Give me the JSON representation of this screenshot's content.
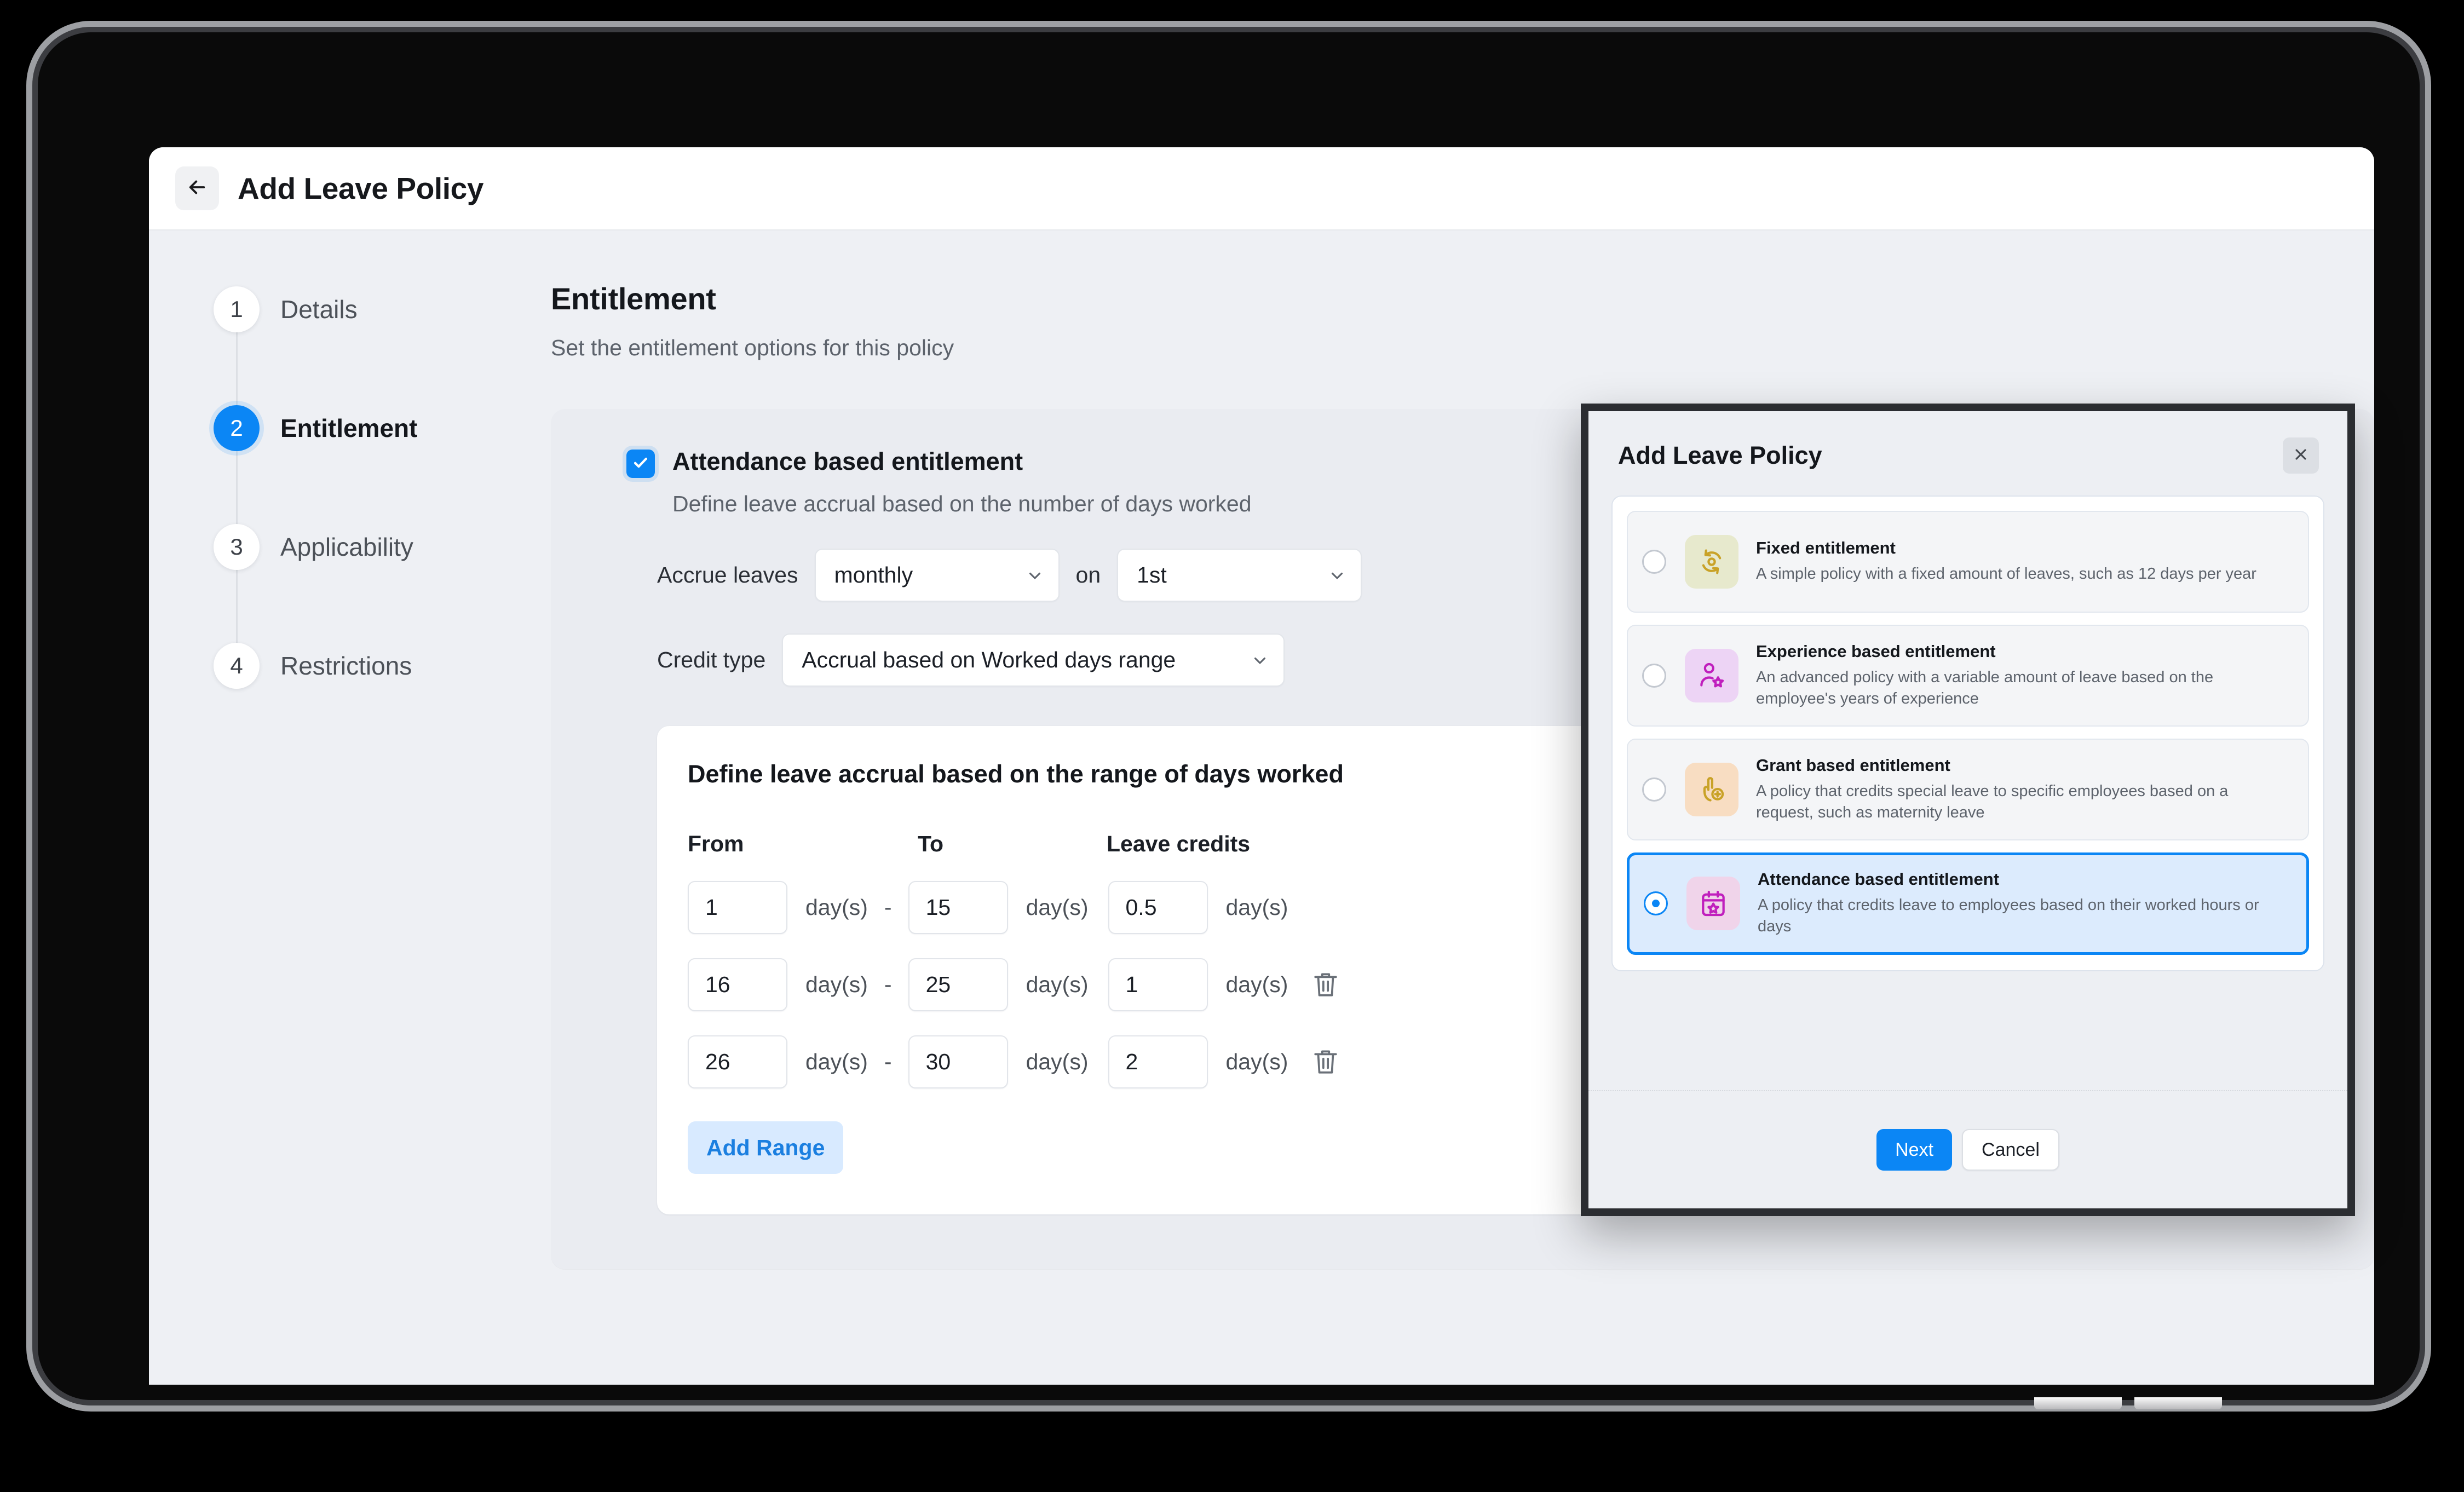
{
  "colors": {
    "accent": "#0b86f5",
    "panel_bg": "#eef0f4",
    "card_bg": "#eaecf1",
    "modal_border": "#2b2d31",
    "add_range_bg": "#d8eaff",
    "add_range_fg": "#1b7fe0"
  },
  "topbar": {
    "back_icon": "arrow-left-icon",
    "title": "Add Leave Policy"
  },
  "sidebar": {
    "steps": [
      {
        "num": "1",
        "label": "Details",
        "active": false
      },
      {
        "num": "2",
        "label": "Entitlement",
        "active": true
      },
      {
        "num": "3",
        "label": "Applicability",
        "active": false
      },
      {
        "num": "4",
        "label": "Restrictions",
        "active": false
      }
    ]
  },
  "main": {
    "title": "Entitlement",
    "subtitle": "Set the entitlement options for this policy",
    "entitlement": {
      "checkbox_checked": true,
      "checkbox_icon": "check-icon",
      "title": "Attendance based entitlement",
      "description": "Define leave accrual based on the number of days worked",
      "accrue_label": "Accrue leaves",
      "accrue_frequency": "monthly",
      "on_label": "on",
      "accrue_day": "1st",
      "credit_type_label": "Credit type",
      "credit_type_value": "Accrual based on Worked days range",
      "chevron_icon": "chevron-down-icon"
    },
    "range_card": {
      "title": "Define leave accrual based on the range of days worked",
      "columns": [
        "From",
        "To",
        "Leave credits"
      ],
      "unit": "day(s)",
      "dash": "-",
      "delete_icon": "trash-icon",
      "rows": [
        {
          "from": "1",
          "to": "15",
          "credits": "0.5",
          "deletable": false
        },
        {
          "from": "16",
          "to": "25",
          "credits": "1",
          "deletable": true
        },
        {
          "from": "26",
          "to": "30",
          "credits": "2",
          "deletable": true
        }
      ],
      "add_range_label": "Add Range"
    }
  },
  "modal": {
    "title": "Add Leave Policy",
    "close_icon": "close-icon",
    "options": [
      {
        "title": "Fixed entitlement",
        "description": "A simple policy with a fixed amount of leaves, such as 12 days per year",
        "icon": "refresh-circle-icon",
        "icon_bg": "#e7e9cd",
        "icon_fg": "#c9a227",
        "selected": false
      },
      {
        "title": "Experience based entitlement",
        "description": "An advanced policy with a variable amount of leave based on the employee's years of experience",
        "icon": "user-star-icon",
        "icon_bg": "#edd4f5",
        "icon_fg": "#c01fbd",
        "selected": false
      },
      {
        "title": "Grant based entitlement",
        "description": "A policy that credits special leave to specific employees based on a request, such as maternity leave",
        "icon": "hand-plus-icon",
        "icon_bg": "#f8ddc2",
        "icon_fg": "#c9a227",
        "selected": false
      },
      {
        "title": "Attendance based entitlement",
        "description": "A policy that credits leave to employees based on their worked hours or days",
        "icon": "calendar-star-icon",
        "icon_bg": "#f0d4ea",
        "icon_fg": "#c01fbd",
        "selected": true
      }
    ],
    "next_label": "Next",
    "cancel_label": "Cancel"
  }
}
